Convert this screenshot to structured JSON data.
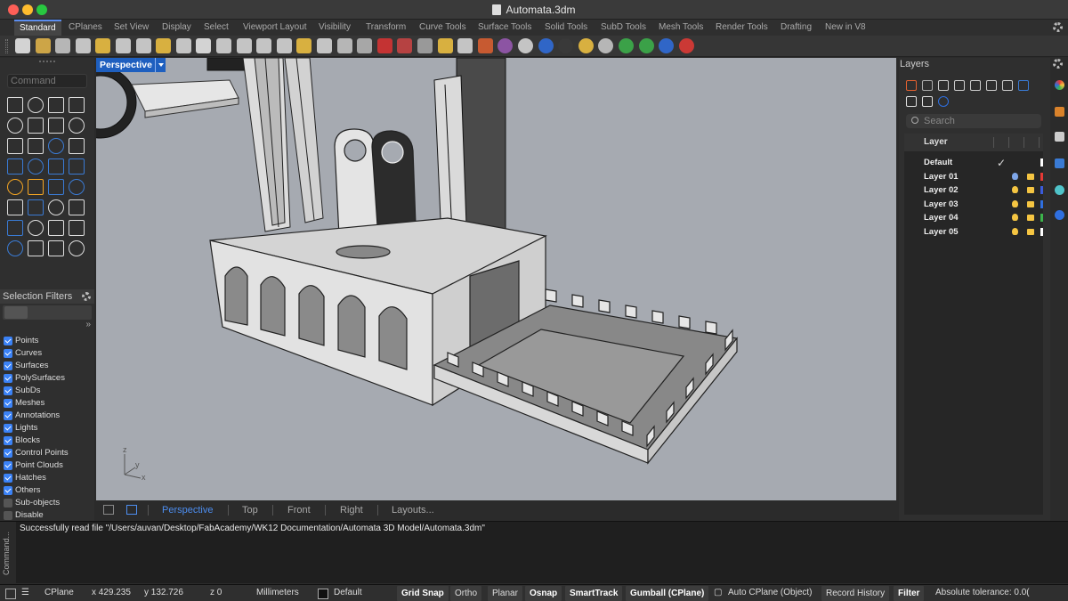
{
  "window": {
    "title": "Automata.3dm"
  },
  "tabs": [
    "Standard",
    "CPlanes",
    "Set View",
    "Display",
    "Select",
    "Viewport Layout",
    "Visibility",
    "Transform",
    "Curve Tools",
    "Surface Tools",
    "Solid Tools",
    "SubD Tools",
    "Mesh Tools",
    "Render Tools",
    "Drafting",
    "New in V8"
  ],
  "toolbar_icons": [
    "new-icon",
    "open-icon",
    "save-icon",
    "print-icon",
    "import-icon",
    "cut-icon",
    "copy-icon",
    "paste-icon",
    "undo-icon",
    "pan-icon",
    "rotate-view-icon",
    "zoom-icon",
    "zoom-window-icon",
    "zoom-extents-icon",
    "zoom-selected-icon",
    "undo-view-icon",
    "viewport-layout-icon",
    "grid-icon",
    "shaded-car-icon",
    "rendered-car-icon",
    "curve-icon",
    "bulb-icon",
    "lock-icon",
    "layer-icon",
    "color-wheel-icon",
    "sphere-icon",
    "render-sphere-icon",
    "material-sphere-icon",
    "sun-icon",
    "dimension-icon",
    "render-icon",
    "globe-icon",
    "help-icon",
    "chat-icon"
  ],
  "command": {
    "placeholder": "Command"
  },
  "selection_filters": {
    "title": "Selection Filters",
    "more": "»",
    "items": [
      {
        "label": "Points",
        "checked": true
      },
      {
        "label": "Curves",
        "checked": true
      },
      {
        "label": "Surfaces",
        "checked": true
      },
      {
        "label": "PolySurfaces",
        "checked": true
      },
      {
        "label": "SubDs",
        "checked": true
      },
      {
        "label": "Meshes",
        "checked": true
      },
      {
        "label": "Annotations",
        "checked": true
      },
      {
        "label": "Lights",
        "checked": true
      },
      {
        "label": "Blocks",
        "checked": true
      },
      {
        "label": "Control Points",
        "checked": true
      },
      {
        "label": "Point Clouds",
        "checked": true
      },
      {
        "label": "Hatches",
        "checked": true
      },
      {
        "label": "Others",
        "checked": true
      },
      {
        "label": "Sub-objects",
        "checked": false
      },
      {
        "label": "Disable",
        "checked": false
      }
    ]
  },
  "viewport": {
    "label": "Perspective",
    "axes": {
      "z": "z",
      "y": "y",
      "x": "x"
    },
    "background": "#a6aab1"
  },
  "viewport_tabs": [
    "Perspective",
    "Top",
    "Front",
    "Right",
    "Layouts..."
  ],
  "layers": {
    "title": "Layers",
    "search_placeholder": "Search",
    "column": "Layer",
    "rows": [
      {
        "name": "Default",
        "current": true,
        "color": "#ffffff"
      },
      {
        "name": "Layer 01",
        "bulb": "blue",
        "color": "#e53935"
      },
      {
        "name": "Layer 02",
        "bulb": "yellow",
        "color": "#3b5bdb"
      },
      {
        "name": "Layer 03",
        "bulb": "yellow",
        "color": "#2f6fe0"
      },
      {
        "name": "Layer 04",
        "bulb": "yellow",
        "color": "#3cb44b"
      },
      {
        "name": "Layer 05",
        "bulb": "yellow",
        "color": "#ffffff"
      }
    ]
  },
  "command_history": {
    "side_label": "Command...",
    "message": "Successfully read file \"/Users/auvan/Desktop/FabAcademy/WK12 Documentation/Automata 3D Model/Automata.3dm\""
  },
  "status": {
    "cplane": "CPlane",
    "x": "x 429.235",
    "y": "y 132.726",
    "z": "z 0",
    "units": "Millimeters",
    "layer": "Default",
    "grid_snap": "Grid Snap",
    "ortho": "Ortho",
    "planar": "Planar",
    "osnap": "Osnap",
    "smarttrack": "SmartTrack",
    "gumball": "Gumball (CPlane)",
    "auto_cplane": "Auto CPlane (Object)",
    "record_history": "Record History",
    "filter": "Filter",
    "tolerance": "Absolute tolerance: 0.0("
  },
  "colors": {
    "accent": "#1e5fbf",
    "tab_active": "#4d8ef0",
    "checkbox": "#3b82f6"
  }
}
